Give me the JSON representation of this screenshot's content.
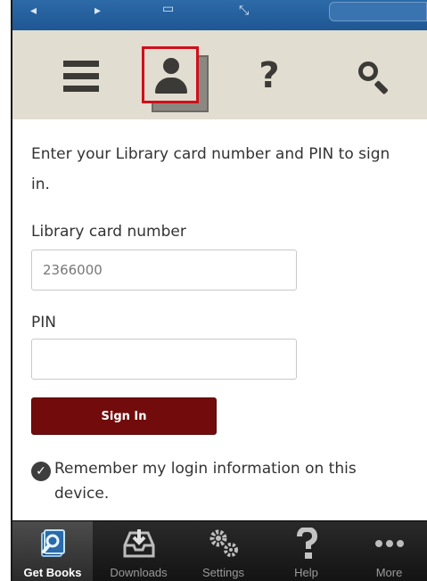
{
  "toolbar": {
    "help_glyph": "?"
  },
  "signin": {
    "intro": "Enter your Library card number and PIN to sign in.",
    "card_label": "Library card number",
    "card_value": "2366000",
    "pin_label": "PIN",
    "pin_value": "",
    "button_label": "Sign In",
    "remember_label": "Remember my login information on this device.",
    "remember_checked": true
  },
  "tabs": [
    {
      "label": "Get Books",
      "icon": "get-books-icon",
      "active": true
    },
    {
      "label": "Downloads",
      "icon": "downloads-icon",
      "active": false
    },
    {
      "label": "Settings",
      "icon": "settings-icon",
      "active": false
    },
    {
      "label": "Help",
      "icon": "help-icon",
      "active": false
    },
    {
      "label": "More",
      "icon": "more-icon",
      "active": false
    }
  ],
  "colors": {
    "accent": "#720c0c",
    "toolbar_bg": "#e1ddd0",
    "highlight": "#d0101a",
    "status_bar": "#2d6aa8",
    "tab_bar": "#1a1a1a"
  }
}
